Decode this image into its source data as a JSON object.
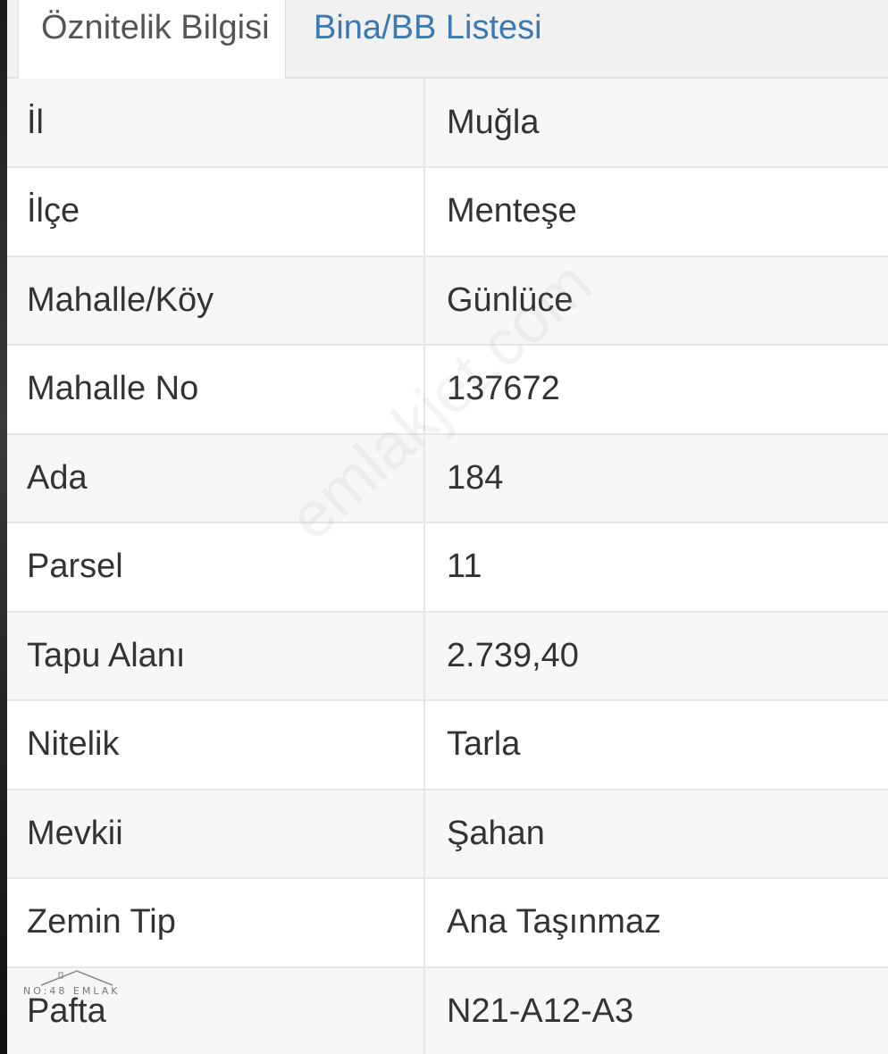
{
  "tabs": [
    {
      "label": "Öznitelik Bilgisi",
      "active": true
    },
    {
      "label": "Bina/BB Listesi",
      "active": false
    }
  ],
  "rows": [
    {
      "label": "İl",
      "value": "Muğla"
    },
    {
      "label": "İlçe",
      "value": "Menteşe"
    },
    {
      "label": "Mahalle/Köy",
      "value": "Günlüce"
    },
    {
      "label": "Mahalle No",
      "value": "137672"
    },
    {
      "label": "Ada",
      "value": "184"
    },
    {
      "label": "Parsel",
      "value": "11"
    },
    {
      "label": "Tapu Alanı",
      "value": "2.739,40"
    },
    {
      "label": "Nitelik",
      "value": "Tarla"
    },
    {
      "label": "Mevkii",
      "value": "Şahan"
    },
    {
      "label": "Zemin Tip",
      "value": "Ana Taşınmaz"
    },
    {
      "label": "Pafta",
      "value": "N21-A12-A3"
    }
  ],
  "watermark": "emlakjet.com",
  "logo": "NO:48 EMLAK",
  "colors": {
    "active_tab_text": "#555555",
    "inactive_tab_text": "#3a79b2",
    "row_alt": "#f7f7f7",
    "border": "#e6e6e6"
  }
}
